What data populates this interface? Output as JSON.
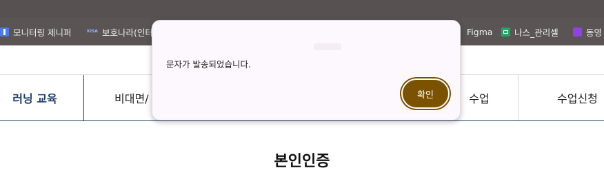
{
  "bookmarks": [
    {
      "label": "모니터링 제니퍼",
      "icon": "pin-icon"
    },
    {
      "label": "보호나라(인터",
      "icon": "kisa-icon",
      "icon_text": "KISA"
    },
    {
      "label": "Figma",
      "icon": ""
    },
    {
      "label": "나스_관리셀",
      "icon": "spreadsheet-icon"
    },
    {
      "label": "동영",
      "icon": "folder-icon"
    }
  ],
  "tabs": [
    {
      "label": "러닝 교육",
      "active": true
    },
    {
      "label": "비대면/",
      "active": false
    },
    {
      "label": "수업",
      "active": false
    },
    {
      "label": "수업신청",
      "active": false
    }
  ],
  "page": {
    "title": "본인인증"
  },
  "dialog": {
    "message": "문자가 발송되었습니다.",
    "confirm_label": "확인"
  },
  "colors": {
    "navy": "#1f3d6b",
    "button_brown": "#7a5200",
    "dialog_bg": "#fdf8fd",
    "browser_bar": "#5a5454"
  }
}
